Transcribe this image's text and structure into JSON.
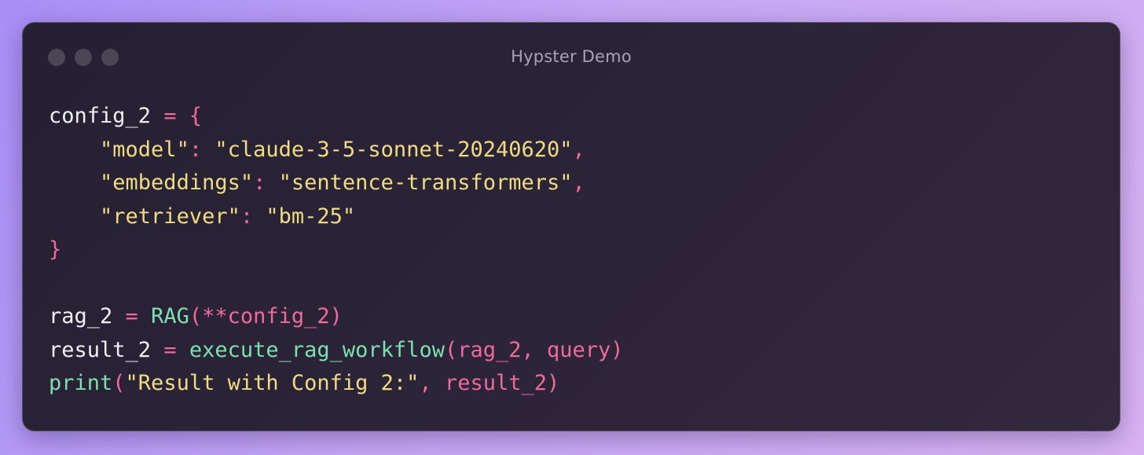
{
  "window": {
    "title": "Hypster Demo",
    "traffic_lights": [
      "close-dot",
      "minimize-dot",
      "zoom-dot"
    ]
  },
  "colors": {
    "background_start": "#a98ef6",
    "background_end": "#d8b2f2",
    "window_bg": "#2a2336",
    "text_default": "#f2eef6",
    "operator": "#f06a9e",
    "string": "#f0dc82",
    "function": "#7ee0b0",
    "title_text": "#a8a3b2"
  },
  "code": {
    "lines": [
      [
        {
          "t": "config_2",
          "k": "default"
        },
        {
          "t": " ",
          "k": "default"
        },
        {
          "t": "=",
          "k": "op"
        },
        {
          "t": " ",
          "k": "default"
        },
        {
          "t": "{",
          "k": "op"
        }
      ],
      [
        {
          "t": "    ",
          "k": "default"
        },
        {
          "t": "\"model\"",
          "k": "str"
        },
        {
          "t": ":",
          "k": "op"
        },
        {
          "t": " ",
          "k": "default"
        },
        {
          "t": "\"claude-3-5-sonnet-20240620\"",
          "k": "str"
        },
        {
          "t": ",",
          "k": "op"
        }
      ],
      [
        {
          "t": "    ",
          "k": "default"
        },
        {
          "t": "\"embeddings\"",
          "k": "str"
        },
        {
          "t": ":",
          "k": "op"
        },
        {
          "t": " ",
          "k": "default"
        },
        {
          "t": "\"sentence-transformers\"",
          "k": "str"
        },
        {
          "t": ",",
          "k": "op"
        }
      ],
      [
        {
          "t": "    ",
          "k": "default"
        },
        {
          "t": "\"retriever\"",
          "k": "str"
        },
        {
          "t": ":",
          "k": "op"
        },
        {
          "t": " ",
          "k": "default"
        },
        {
          "t": "\"bm-25\"",
          "k": "str"
        }
      ],
      [
        {
          "t": "}",
          "k": "op"
        }
      ],
      [],
      [
        {
          "t": "rag_2",
          "k": "default"
        },
        {
          "t": " ",
          "k": "default"
        },
        {
          "t": "=",
          "k": "op"
        },
        {
          "t": " ",
          "k": "default"
        },
        {
          "t": "RAG",
          "k": "func"
        },
        {
          "t": "(**config_2)",
          "k": "op"
        }
      ],
      [
        {
          "t": "result_2",
          "k": "default"
        },
        {
          "t": " ",
          "k": "default"
        },
        {
          "t": "=",
          "k": "op"
        },
        {
          "t": " ",
          "k": "default"
        },
        {
          "t": "execute_rag_workflow",
          "k": "func"
        },
        {
          "t": "(rag_2, query)",
          "k": "op"
        }
      ],
      [
        {
          "t": "print",
          "k": "func"
        },
        {
          "t": "(",
          "k": "op"
        },
        {
          "t": "\"Result with Config 2:\"",
          "k": "str"
        },
        {
          "t": ", result_2)",
          "k": "op"
        }
      ]
    ]
  }
}
